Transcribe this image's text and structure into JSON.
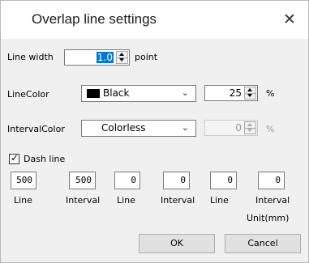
{
  "dialog": {
    "title": "Overlap line settings",
    "close_glyph": "✕"
  },
  "line_width": {
    "label": "Line width",
    "value": "1.0",
    "unit": "point"
  },
  "line_color": {
    "label": "LineColor",
    "selected": "Black",
    "swatch": "#000000",
    "percent": "25",
    "percent_unit": "%"
  },
  "interval_color": {
    "label": "IntervalColor",
    "selected": "Colorless",
    "percent": "0",
    "percent_unit": "%"
  },
  "dash": {
    "checkbox_label": "Dash line",
    "checked": true,
    "values": [
      "500",
      "500",
      "0",
      "0",
      "0",
      "0"
    ],
    "captions": [
      "Line",
      "Interval",
      "Line",
      "Interval",
      "Line",
      "Interval"
    ],
    "unit": "Unit(mm)"
  },
  "buttons": {
    "ok": "OK",
    "cancel": "Cancel"
  },
  "icons": {
    "spin_up": "triangle-up-icon",
    "spin_down": "triangle-down-icon",
    "dropdown": "chevron-down-icon",
    "close": "close-icon",
    "check": "checkmark-icon"
  }
}
